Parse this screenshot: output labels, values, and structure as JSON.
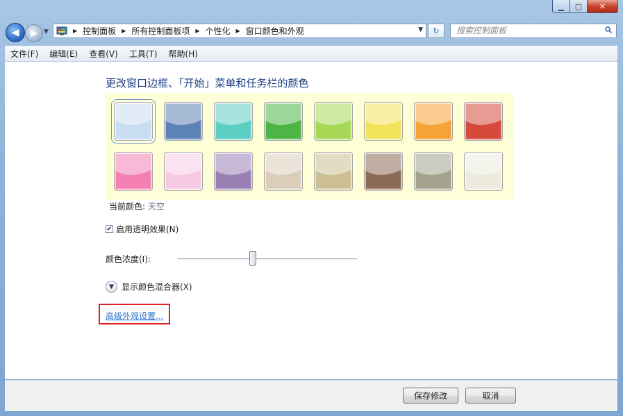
{
  "window": {
    "title": "",
    "controls": {
      "minimize": "▁",
      "maximize": "▢",
      "close": "✕"
    }
  },
  "nav": {
    "breadcrumbs": [
      "控制面板",
      "所有控制面板项",
      "个性化",
      "窗口颜色和外观"
    ],
    "search_placeholder": "搜索控制面板"
  },
  "menu": [
    "文件(F)",
    "编辑(E)",
    "查看(V)",
    "工具(T)",
    "帮助(H)"
  ],
  "main": {
    "heading": "更改窗口边框、「开始」菜单和任务栏的颜色",
    "swatches_row1": [
      "#c9ddf3",
      "#5d82b5",
      "#5dcec2",
      "#4eb446",
      "#a6d856",
      "#f2e25a",
      "#f7a236",
      "#d44a3b"
    ],
    "swatches_row2": [
      "#f47fb3",
      "#f6cbe2",
      "#9a7fb2",
      "#dccdbb",
      "#cbbf93",
      "#8c6a55",
      "#a3a38d",
      "#ecebde"
    ],
    "current_color_label": "当前颜色:",
    "current_color_value": "天空",
    "transparency_label": "启用透明效果(N)",
    "transparency_checked": true,
    "intensity_label": "颜色浓度(I):",
    "intensity_fraction": 0.42,
    "mixer_label": "显示颜色混合器(X)",
    "advanced_link": "高级外观设置..."
  },
  "footer": {
    "save_label": "保存修改",
    "cancel_label": "取消"
  }
}
